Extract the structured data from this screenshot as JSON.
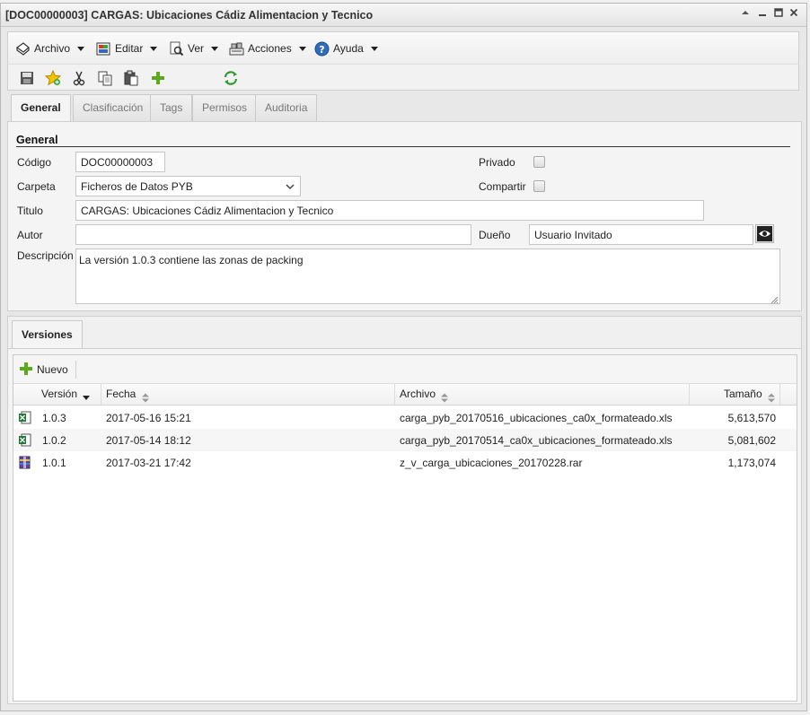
{
  "window": {
    "title": "[DOC00000003] CARGAS: Ubicaciones Cádiz Alimentacion y Tecnico"
  },
  "menu": {
    "items": [
      {
        "label": "Archivo",
        "icon": "archive-icon"
      },
      {
        "label": "Editar",
        "icon": "edit-icon"
      },
      {
        "label": "Ver",
        "icon": "view-icon"
      },
      {
        "label": "Acciones",
        "icon": "actions-icon"
      },
      {
        "label": "Ayuda",
        "icon": "help-icon"
      }
    ]
  },
  "toolbar": {
    "buttons": [
      "save-icon",
      "star-icon",
      "cut-icon",
      "copy-icon",
      "paste-icon",
      "add-icon",
      "refresh-icon"
    ]
  },
  "tabs": [
    {
      "label": "General",
      "active": true
    },
    {
      "label": "Clasificación",
      "active": false
    },
    {
      "label": "Tags",
      "active": false
    },
    {
      "label": "Permisos",
      "active": false
    },
    {
      "label": "Auditoria",
      "active": false
    }
  ],
  "general": {
    "section_title": "General",
    "codigo_label": "Código",
    "codigo_value": "DOC00000003",
    "carpeta_label": "Carpeta",
    "carpeta_value": "Ficheros de Datos PYB",
    "titulo_label": "Titulo",
    "titulo_value": "CARGAS: Ubicaciones Cádiz Alimentacion y Tecnico",
    "autor_label": "Autor",
    "autor_value": "",
    "descripcion_label": "Descripción",
    "descripcion_value": "La versión 1.0.3 contiene las zonas de packing",
    "privado_label": "Privado",
    "privado_checked": false,
    "compartir_label": "Compartir",
    "compartir_checked": false,
    "dueno_label": "Dueño",
    "dueno_value": "Usuario Invitado"
  },
  "versions": {
    "tab_label": "Versiones",
    "new_button_label": "Nuevo",
    "columns": {
      "version": "Versión",
      "fecha": "Fecha",
      "archivo": "Archivo",
      "tamano": "Tamaño"
    },
    "rows": [
      {
        "icon": "excel-file-icon",
        "version": "1.0.3",
        "fecha": "2017-05-16 15:21",
        "archivo": "carga_pyb_20170516_ubicaciones_ca0x_formateado.xls",
        "tamano": "5,613,570"
      },
      {
        "icon": "excel-file-icon",
        "version": "1.0.2",
        "fecha": "2017-05-14 18:12",
        "archivo": "carga_pyb_20170514_ca0x_ubicaciones_formateado.xls",
        "tamano": "5,081,602"
      },
      {
        "icon": "rar-file-icon",
        "version": "1.0.1",
        "fecha": "2017-03-21 17:42",
        "archivo": "z_v_carga_ubicaciones_20170228.rar",
        "tamano": "1,173,074"
      }
    ]
  }
}
